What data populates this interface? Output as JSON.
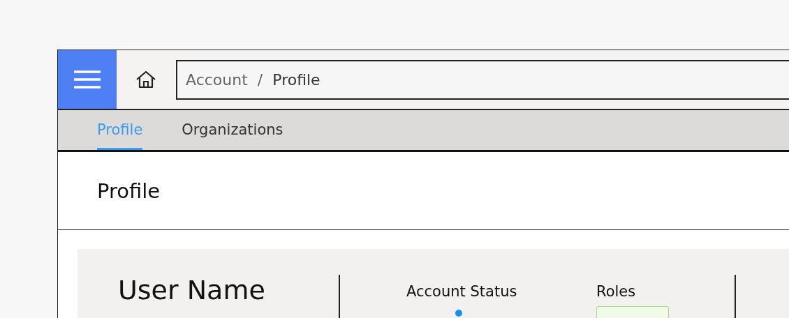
{
  "breadcrumb": [
    "Account",
    "Profile"
  ],
  "breadcrumb_separator": "/",
  "tabs": [
    {
      "label": "Profile",
      "selected": true
    },
    {
      "label": "Organizations",
      "selected": false
    }
  ],
  "page_title": "Profile",
  "user": {
    "name": "User Name"
  },
  "account_status": {
    "label": "Account Status"
  },
  "roles": {
    "label": "Roles"
  }
}
